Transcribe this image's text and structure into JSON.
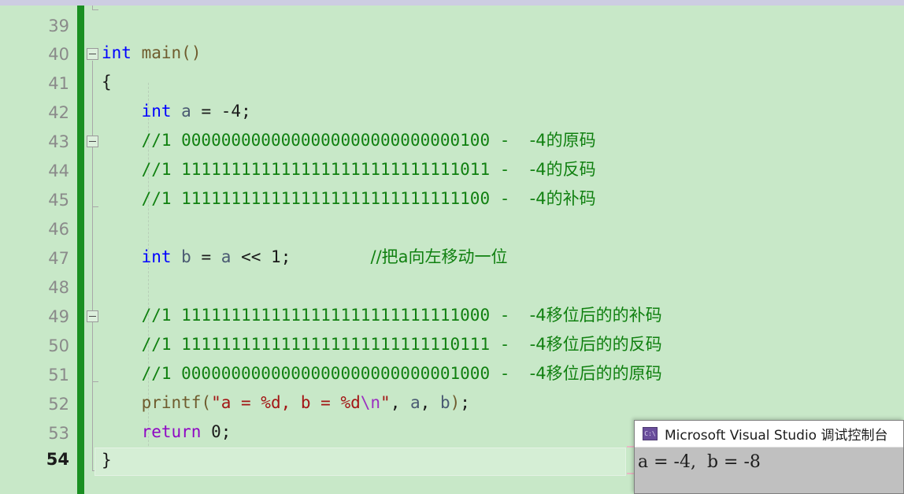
{
  "window": {
    "top_band_color": "#cdcde2",
    "editor_background": "#c8e8c8",
    "change_bar_color": "#1a8f22"
  },
  "editor": {
    "first_visible_line": 39,
    "active_line": 54,
    "line_numbers": [
      "39",
      "40",
      "41",
      "42",
      "43",
      "44",
      "45",
      "46",
      "47",
      "48",
      "49",
      "50",
      "51",
      "52",
      "53",
      "54"
    ],
    "lines": [
      {
        "n": "39",
        "text": ""
      },
      {
        "n": "40",
        "text": "int main()"
      },
      {
        "n": "41",
        "text": " {"
      },
      {
        "n": "42",
        "text": "     int a = -4;"
      },
      {
        "n": "43",
        "text": "     //1 0000000000000000000000000000100 -  -4的原码"
      },
      {
        "n": "44",
        "text": "     //1 1111111111111111111111111111011 -  -4的反码"
      },
      {
        "n": "45",
        "text": "     //1 1111111111111111111111111111100 -  -4的补码"
      },
      {
        "n": "46",
        "text": ""
      },
      {
        "n": "47",
        "text": "     int b = a << 1;        //把a向左移动一位"
      },
      {
        "n": "48",
        "text": ""
      },
      {
        "n": "49",
        "text": "     //1 1111111111111111111111111111000 -  -4移位后的的补码"
      },
      {
        "n": "50",
        "text": "     //1 1111111111111111111111111110111 -  -4移位后的的反码"
      },
      {
        "n": "51",
        "text": "     //1 0000000000000000000000000001000 -  -4移位后的的原码"
      },
      {
        "n": "52",
        "text": "     printf(\"a = %d, b = %d\\n\", a, b);"
      },
      {
        "n": "53",
        "text": "     return 0;"
      },
      {
        "n": "54",
        "text": " }"
      }
    ],
    "tokens": {
      "kw_int": "int",
      "kw_return": "return",
      "fn_main": "main",
      "fn_printf": "printf",
      "var_a": "a",
      "var_b": "b",
      "literal_minus4": "-4",
      "literal_1": "1",
      "literal_0": "0",
      "str_format": "\"a = %d, b = %d",
      "str_escape": "\\n",
      "str_close": "\"",
      "shift_op": "<<",
      "brace_open": "{",
      "brace_close": "}"
    },
    "comments": {
      "c43_bits": "//1 0000000000000000000000000000100 -  ",
      "c43_cn": "-4的原码",
      "c44_bits": "//1 1111111111111111111111111111011 -  ",
      "c44_cn": "-4的反码",
      "c45_bits": "//1 1111111111111111111111111111100 -  ",
      "c45_cn": "-4的补码",
      "c47_cn": "//把a向左移动一位",
      "c49_bits": "//1 1111111111111111111111111111000 -  ",
      "c49_cn": "-4移位后的的补码",
      "c50_bits": "//1 1111111111111111111111111110111 -  ",
      "c50_cn": "-4移位后的的反码",
      "c51_bits": "//1 0000000000000000000000000001000 -  ",
      "c51_cn": "-4移位后的的原码"
    },
    "colors": {
      "keyword": "#0000ff",
      "keyword_return": "#8f08c4",
      "comment": "#108010",
      "string": "#a31515",
      "escape": "#9b30c0",
      "function": "#6f5c2e",
      "identifier": "#4a5a72",
      "line_number": "#8a8a8a"
    }
  },
  "console": {
    "icon_label": "C:\\",
    "title": "Microsoft Visual Studio 调试控制台",
    "output": "a = -4,  b = -8",
    "background": "#c0c0c0",
    "titlebar_background": "#ffffff"
  }
}
